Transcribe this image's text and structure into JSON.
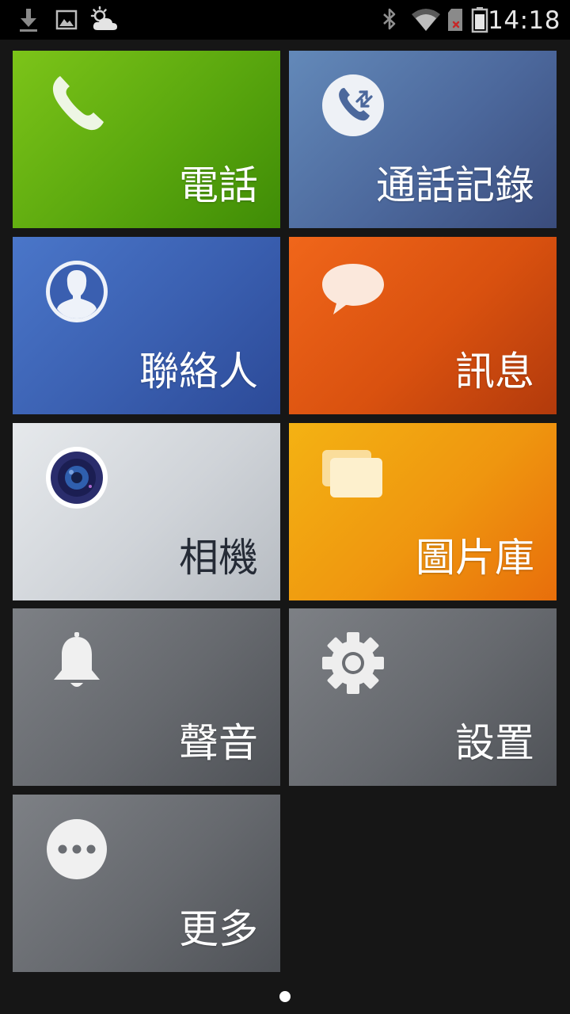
{
  "status_bar": {
    "time": "14:18",
    "icons": [
      "download-icon",
      "image-icon",
      "weather-cloud-sun-icon",
      "bluetooth-icon",
      "wifi-icon",
      "sim-no-signal-icon",
      "battery-icon"
    ]
  },
  "tiles": [
    {
      "id": "phone",
      "label": "電話",
      "icon": "phone-icon",
      "color": "#5aa70e"
    },
    {
      "id": "call-log",
      "label": "通話記錄",
      "icon": "call-log-icon",
      "color": "#4c689c"
    },
    {
      "id": "contacts",
      "label": "聯絡人",
      "icon": "contact-person-icon",
      "color": "#3a5fb0"
    },
    {
      "id": "messages",
      "label": "訊息",
      "icon": "message-bubble-icon",
      "color": "#d9510f"
    },
    {
      "id": "camera",
      "label": "相機",
      "icon": "camera-lens-icon",
      "color": "#cfd3d8"
    },
    {
      "id": "gallery",
      "label": "圖片庫",
      "icon": "gallery-icon",
      "color": "#ef960f"
    },
    {
      "id": "sound",
      "label": "聲音",
      "icon": "bell-icon",
      "color": "#66696e"
    },
    {
      "id": "settings",
      "label": "設置",
      "icon": "gear-icon",
      "color": "#66696e"
    },
    {
      "id": "more",
      "label": "更多",
      "icon": "more-dots-icon",
      "color": "#66696e"
    }
  ],
  "pager": {
    "pages": 1,
    "current": 1
  }
}
